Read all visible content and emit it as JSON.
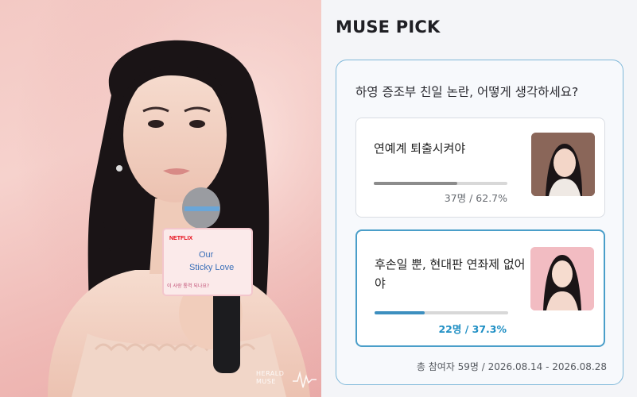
{
  "brand": {
    "title": "MUSE PICK"
  },
  "photo": {
    "sign_brand": "NETFLIX",
    "sign_title_line1": "Our",
    "sign_title_line2": "Sticky Love",
    "sign_korean": "이 사랑 통역 되나요?",
    "watermark_line1": "HERALD",
    "watermark_line2": "MUSE"
  },
  "poll": {
    "question": "하영 증조부 친일 논란, 어떻게 생각하세요?",
    "options": [
      {
        "label": "연예계 퇴출시켜야",
        "result": "37명 / 62.7%",
        "fraction": 0.627
      },
      {
        "label": "후손일 뿐, 현대판 연좌제 없어야",
        "result": "22명 / 37.3%",
        "fraction": 0.373
      }
    ],
    "footer": "총 참여자 59명 / 2026.08.14 - 2026.08.28"
  },
  "colors": {
    "accent": "#4a9ec9",
    "accent_text": "#1f8fc4",
    "bar_gray": "#8c8c8c",
    "card_border": "#7fb8d9"
  }
}
